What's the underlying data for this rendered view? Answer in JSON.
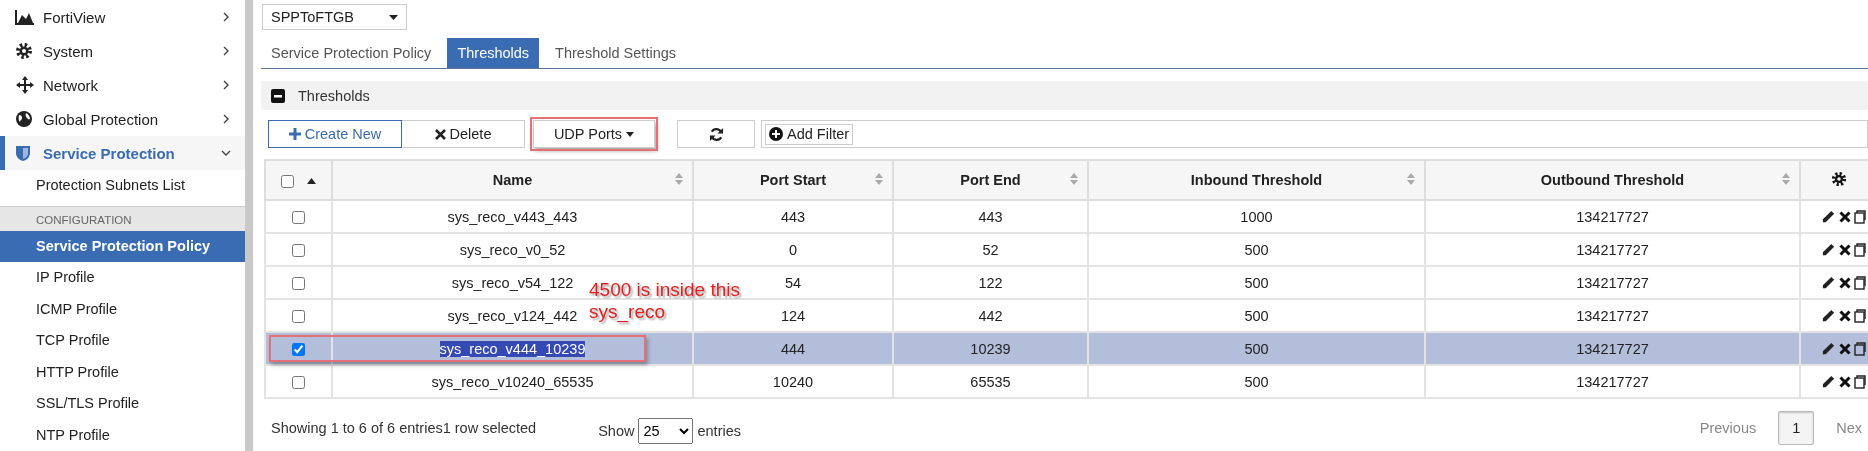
{
  "sidebar": {
    "items": [
      {
        "label": "FortiView",
        "expanded": false,
        "selected": false
      },
      {
        "label": "System",
        "expanded": false,
        "selected": false
      },
      {
        "label": "Network",
        "expanded": false,
        "selected": false
      },
      {
        "label": "Global Protection",
        "expanded": false,
        "selected": false
      },
      {
        "label": "Service Protection",
        "expanded": true,
        "selected": true
      }
    ],
    "sub_items": [
      {
        "label": "Protection Subnets List",
        "selected": false
      }
    ],
    "section_heading": "CONFIGURATION",
    "section_items": [
      {
        "label": "Service Protection Policy",
        "selected": true
      },
      {
        "label": "IP Profile",
        "selected": false
      },
      {
        "label": "ICMP Profile",
        "selected": false
      },
      {
        "label": "TCP Profile",
        "selected": false
      },
      {
        "label": "HTTP Profile",
        "selected": false
      },
      {
        "label": "SSL/TLS Profile",
        "selected": false
      },
      {
        "label": "NTP Profile",
        "selected": false
      }
    ]
  },
  "policy_select": "SPPToFTGB",
  "tabs": [
    {
      "label": "Service Protection Policy",
      "selected": false
    },
    {
      "label": "Thresholds",
      "selected": true
    },
    {
      "label": "Threshold Settings",
      "selected": false
    }
  ],
  "panel": {
    "title": "Thresholds"
  },
  "toolbar": [
    {
      "kind": "create",
      "label": "Create New",
      "highlighted": false
    },
    {
      "kind": "delete",
      "label": "Delete",
      "highlighted": false
    },
    {
      "kind": "dropdown",
      "label": "UDP Ports",
      "highlighted": true
    },
    {
      "kind": "refresh",
      "highlighted": false
    },
    {
      "kind": "filter",
      "label": "Add Filter",
      "highlighted": false
    }
  ],
  "table": {
    "header_checked": false,
    "columns": [
      "Name",
      "Port Start",
      "Port End",
      "Inbound Threshold",
      "Outbound Threshold"
    ],
    "rows": [
      {
        "checked": false,
        "selected": false,
        "text_selected": false,
        "marked": false,
        "cells": [
          "sys_reco_v443_443",
          "443",
          "443",
          "1000",
          "134217727"
        ]
      },
      {
        "checked": false,
        "selected": false,
        "text_selected": false,
        "marked": false,
        "cells": [
          "sys_reco_v0_52",
          "0",
          "52",
          "500",
          "134217727"
        ]
      },
      {
        "checked": false,
        "selected": false,
        "text_selected": false,
        "marked": false,
        "cells": [
          "sys_reco_v54_122",
          "54",
          "122",
          "500",
          "134217727"
        ]
      },
      {
        "checked": false,
        "selected": false,
        "text_selected": false,
        "marked": false,
        "cells": [
          "sys_reco_v124_442",
          "124",
          "442",
          "500",
          "134217727"
        ]
      },
      {
        "checked": true,
        "selected": true,
        "text_selected": true,
        "marked": true,
        "cells": [
          "sys_reco_v444_10239",
          "444",
          "10239",
          "500",
          "134217727"
        ]
      },
      {
        "checked": false,
        "selected": false,
        "text_selected": false,
        "marked": false,
        "cells": [
          "sys_reco_v10240_65535",
          "10240",
          "65535",
          "500",
          "134217727"
        ]
      }
    ]
  },
  "annotation": "4500 is inside this sys_reco",
  "footer": {
    "summary": "Showing 1 to 6 of 6 entries1 row selected",
    "show_label": "Show",
    "page_size": "25",
    "entries_label": "entries",
    "previous": "Previous",
    "pages": [
      {
        "label": "1",
        "selected": true
      }
    ],
    "next": "Nex"
  }
}
